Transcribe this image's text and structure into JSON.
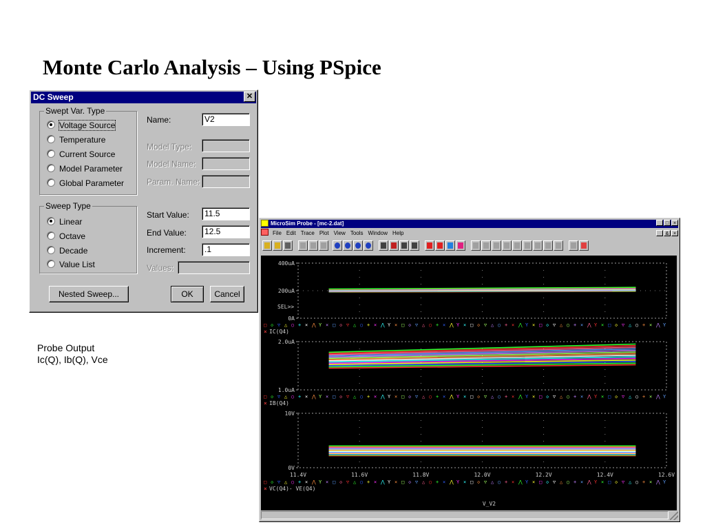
{
  "slide": {
    "title": "Monte Carlo Analysis – Using PSpice",
    "caption_line1": "Probe Output",
    "caption_line2": "Ic(Q), Ib(Q), Vce"
  },
  "dialog": {
    "title": "DC Sweep",
    "close_glyph": "✕",
    "swept_group": "Swept Var. Type",
    "swept_options": [
      {
        "label": "Voltage Source",
        "selected": true
      },
      {
        "label": "Temperature",
        "selected": false
      },
      {
        "label": "Current Source",
        "selected": false
      },
      {
        "label": "Model Parameter",
        "selected": false
      },
      {
        "label": "Global Parameter",
        "selected": false
      }
    ],
    "sweep_group": "Sweep Type",
    "sweep_options": [
      {
        "label": "Linear",
        "selected": true
      },
      {
        "label": "Octave",
        "selected": false
      },
      {
        "label": "Decade",
        "selected": false
      },
      {
        "label": "Value List",
        "selected": false
      }
    ],
    "name_label": "Name:",
    "name_value": "V2",
    "model_type_label": "Model Type:",
    "model_name_label": "Model Name:",
    "param_name_label": "Param. Name:",
    "start_label": "Start Value:",
    "start_value": "11.5",
    "end_label": "End Value:",
    "end_value": "12.5",
    "increment_label": "Increment:",
    "increment_value": ".1",
    "values_label": "Values:",
    "nested_button": "Nested Sweep...",
    "ok_button": "OK",
    "cancel_button": "Cancel"
  },
  "probe": {
    "title": "MicroSim Probe - [mc-2.dat]",
    "menu": [
      "File",
      "Edit",
      "Trace",
      "Plot",
      "View",
      "Tools",
      "Window",
      "Help"
    ],
    "win_min": "_",
    "win_max": "□",
    "win_close": "×",
    "win_restore": "&"
  },
  "chart_data": {
    "type": "line",
    "xlabel": "V_V2",
    "x_ticks": [
      "11.4V",
      "11.6V",
      "11.8V",
      "12.0V",
      "12.2V",
      "12.4V",
      "12.6V"
    ],
    "xlim": [
      11.4,
      12.6
    ],
    "x_data_range": [
      11.5,
      12.5
    ],
    "plots": [
      {
        "trace": "IC(Q4)",
        "y_ticks": [
          "400uA",
          "200uA",
          "0A"
        ],
        "ylim": [
          0,
          400
        ],
        "unit": "uA",
        "sel_marker": "SEL>>",
        "band_start": [
          190,
          212
        ],
        "band_end": [
          195,
          224
        ]
      },
      {
        "trace": "IB(Q4)",
        "y_ticks": [
          "2.0uA",
          "1.0uA"
        ],
        "ylim": [
          1.0,
          2.0
        ],
        "unit": "uA",
        "band_start": [
          1.45,
          1.78
        ],
        "band_end": [
          1.52,
          1.95
        ]
      },
      {
        "trace": "VC(Q4)- VE(Q4)",
        "y_ticks": [
          "10V",
          "0V"
        ],
        "ylim": [
          0,
          10
        ],
        "unit": "V",
        "band_start": [
          2.2,
          4.0
        ],
        "band_end": [
          2.2,
          4.0
        ]
      }
    ],
    "series_colors": [
      "#ff3030",
      "#30ff30",
      "#3060ff",
      "#ffff30",
      "#ff30ff",
      "#30ffff",
      "#ffffff",
      "#ff9040",
      "#a0ff60",
      "#c080ff",
      "#60a0ff",
      "#ff6090"
    ],
    "marker_symbols": [
      "□",
      "◇",
      "▽",
      "△",
      "○",
      "+",
      "×",
      "⋀",
      "Y",
      "×",
      "□",
      "◇",
      "▽",
      "△",
      "○",
      "+",
      "×",
      "⋀",
      "Y",
      "×",
      "□",
      "◇",
      "▽",
      "△",
      "○",
      "+",
      "×",
      "⋀",
      "Y",
      "×",
      "□",
      "◇",
      "▽",
      "△",
      "○",
      "+",
      "×",
      "⋀",
      "Y",
      "×",
      "□",
      "◇",
      "▽",
      "△",
      "○",
      "+",
      "×",
      "⋀",
      "Y",
      "×",
      "□",
      "◇",
      "▽",
      "△",
      "○",
      "+",
      "×",
      "⋀",
      "Y"
    ]
  }
}
